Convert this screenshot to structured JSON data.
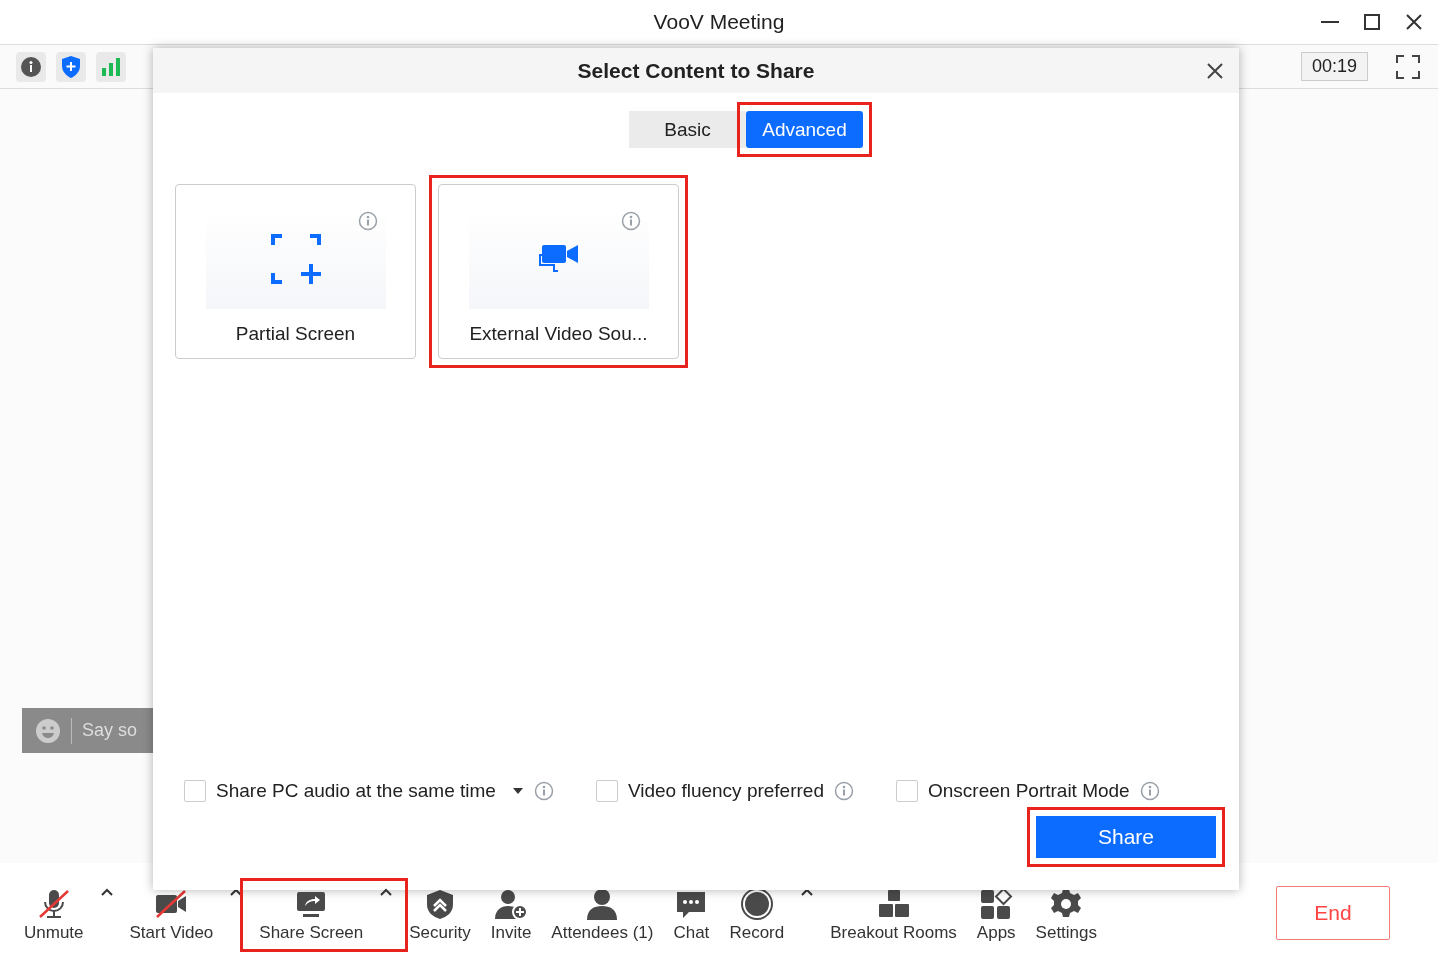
{
  "window": {
    "title": "VooV Meeting"
  },
  "top_bar": {
    "timer": "00:19"
  },
  "chat_input": {
    "placeholder": "Say so"
  },
  "dialog": {
    "title": "Select Content to Share",
    "tabs": [
      {
        "label": "Basic",
        "selected": false,
        "highlighted": false
      },
      {
        "label": "Advanced",
        "selected": true,
        "highlighted": true
      }
    ],
    "cards": [
      {
        "label": "Partial Screen",
        "kind": "partial",
        "highlighted": false
      },
      {
        "label": "External Video Sou...",
        "kind": "camera",
        "highlighted": true
      }
    ],
    "options": [
      {
        "label": "Share PC audio at the same time",
        "checked": false,
        "dropdown": true
      },
      {
        "label": "Video fluency preferred",
        "checked": false,
        "dropdown": false
      },
      {
        "label": "Onscreen Portrait Mode",
        "checked": false,
        "dropdown": false
      }
    ],
    "share_button": {
      "label": "Share",
      "highlighted": true
    }
  },
  "toolbar": [
    {
      "label": "Unmute",
      "kind": "mic",
      "muted": true,
      "caret": true,
      "highlighted": false
    },
    {
      "label": "Start Video",
      "kind": "video",
      "muted": true,
      "caret": true,
      "highlighted": false
    },
    {
      "label": "Share Screen",
      "kind": "share",
      "muted": false,
      "caret": true,
      "highlighted": true
    },
    {
      "label": "Security",
      "kind": "security",
      "muted": false,
      "caret": false,
      "highlighted": false
    },
    {
      "label": "Invite",
      "kind": "invite",
      "muted": false,
      "caret": false,
      "highlighted": false
    },
    {
      "label": "Attendees (1)",
      "kind": "attendees",
      "muted": false,
      "caret": false,
      "highlighted": false
    },
    {
      "label": "Chat",
      "kind": "chat",
      "muted": false,
      "caret": false,
      "highlighted": false
    },
    {
      "label": "Record",
      "kind": "record",
      "muted": false,
      "caret": true,
      "highlighted": false
    },
    {
      "label": "Breakout Rooms",
      "kind": "rooms",
      "muted": false,
      "caret": false,
      "highlighted": false
    },
    {
      "label": "Apps",
      "kind": "apps",
      "muted": false,
      "caret": false,
      "highlighted": false
    },
    {
      "label": "Settings",
      "kind": "settings",
      "muted": false,
      "caret": false,
      "highlighted": false
    }
  ],
  "end_button": {
    "label": "End"
  }
}
